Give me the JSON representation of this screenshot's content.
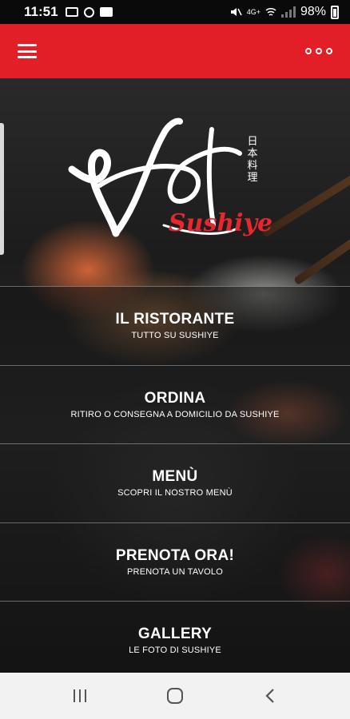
{
  "status_bar": {
    "time": "11:51",
    "network_label": "4G+",
    "battery": "98%",
    "left_icons": [
      "laptop-icon",
      "hand-icon",
      "image-icon"
    ],
    "right_icons": [
      "mute-icon",
      "wifi-calling-icon",
      "signal-icon",
      "battery-icon"
    ]
  },
  "app_bar": {
    "color": "#e21f26",
    "menu_icon": "hamburger-icon",
    "overflow_icon": "more-horizontal-icon"
  },
  "logo": {
    "brand": "Sushiye",
    "kanji": [
      "日",
      "本",
      "料",
      "理"
    ]
  },
  "menu": [
    {
      "title": "IL RISTORANTE",
      "subtitle": "TUTTO SU SUSHIYE"
    },
    {
      "title": "ORDINA",
      "subtitle": "RITIRO O CONSEGNA A DOMICILIO DA SUSHIYE"
    },
    {
      "title": "MENÙ",
      "subtitle": "SCOPRI IL NOSTRO MENÙ"
    },
    {
      "title": "PRENOTA ORA!",
      "subtitle": "PRENOTA UN TAVOLO"
    },
    {
      "title": "GALLERY",
      "subtitle": "LE FOTO DI SUSHIYE"
    }
  ],
  "nav_bar": {
    "buttons": [
      "recent-apps-icon",
      "home-icon",
      "back-icon"
    ]
  }
}
